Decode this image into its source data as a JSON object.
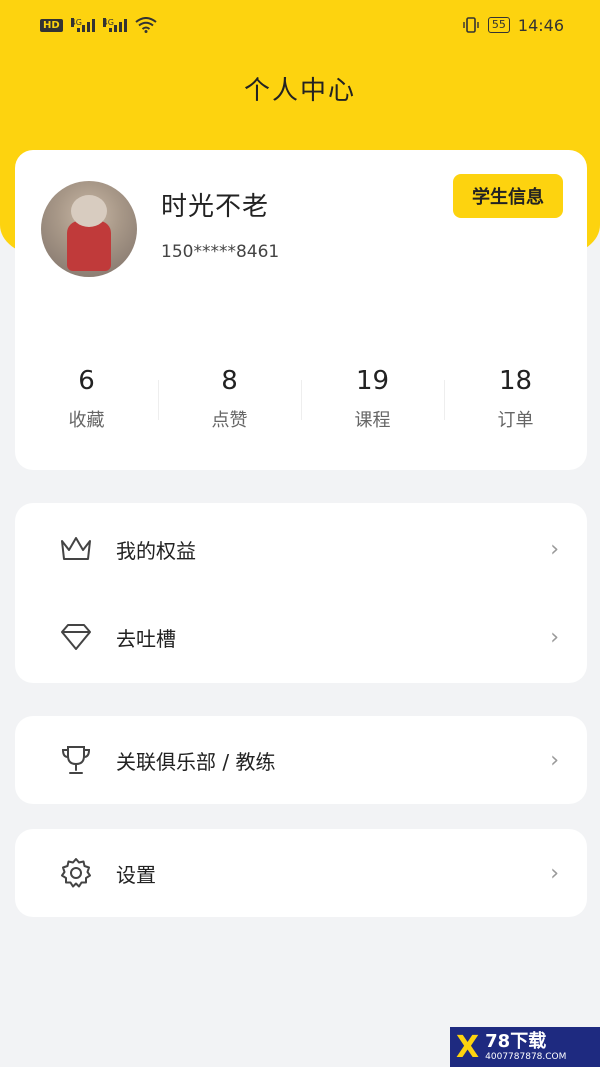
{
  "status_bar": {
    "hd": "HD",
    "net1": "4G",
    "net2": "4G",
    "battery": "55",
    "time": "14:46"
  },
  "header": {
    "title": "个人中心"
  },
  "profile": {
    "name": "时光不老",
    "phone": "150*****8461",
    "student_info_label": "学生信息"
  },
  "stats": [
    {
      "value": "6",
      "label": "收藏"
    },
    {
      "value": "8",
      "label": "点赞"
    },
    {
      "value": "19",
      "label": "课程"
    },
    {
      "value": "18",
      "label": "订单"
    }
  ],
  "menu": {
    "rights": "我的权益",
    "feedback": "去吐槽",
    "club": "关联俱乐部 / 教练",
    "settings": "设置"
  },
  "watermark": {
    "mark": "X",
    "title": "78下载",
    "sub": "4007787878.COM"
  },
  "colors": {
    "accent": "#fdd30f",
    "background": "#f2f3f5"
  }
}
